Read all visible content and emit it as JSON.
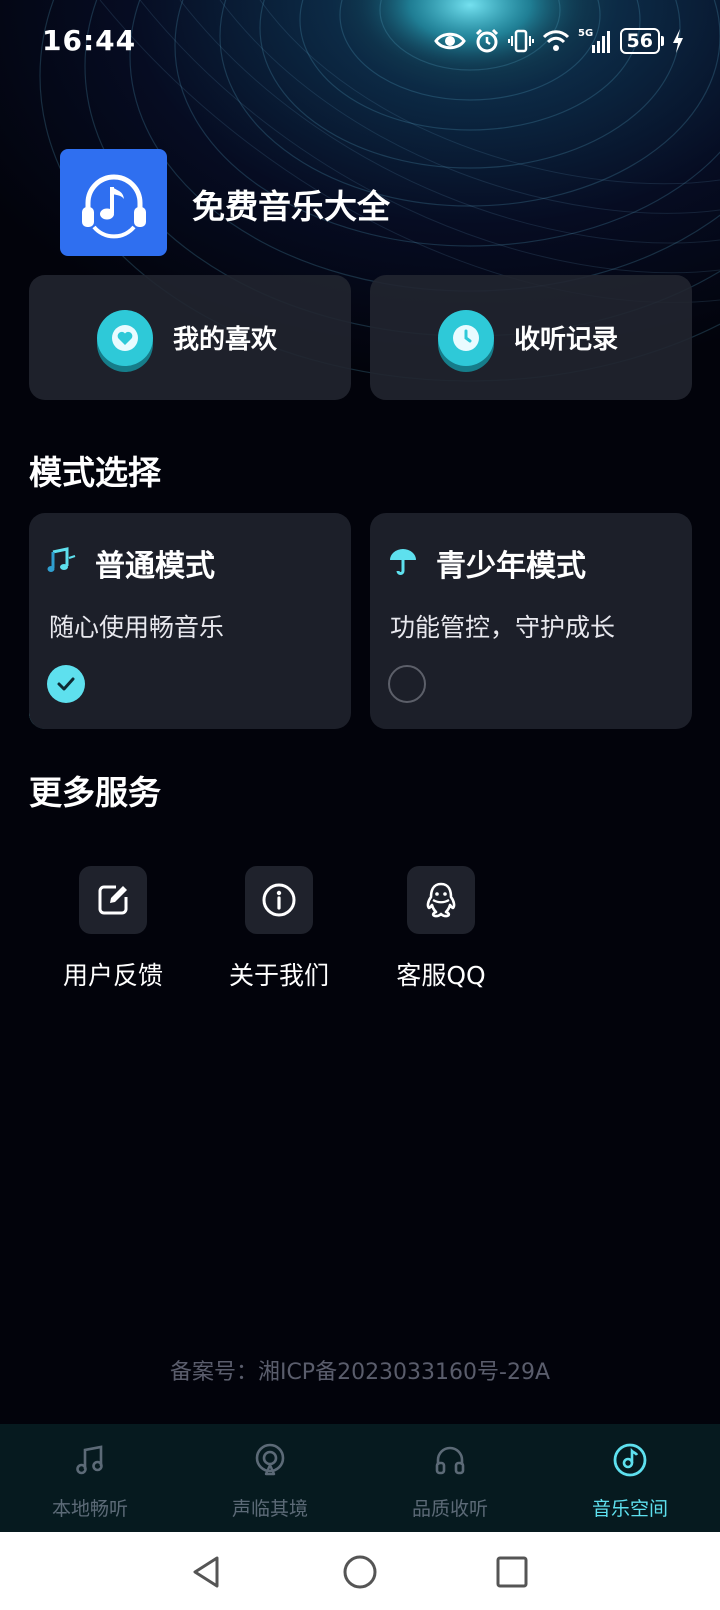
{
  "status_bar": {
    "time": "16:44",
    "network": "5G",
    "battery": "56",
    "icons": [
      "eye-icon",
      "alarm-icon",
      "vibrate-icon",
      "wifi-icon",
      "signal-icon",
      "battery-icon",
      "charging-icon"
    ]
  },
  "header": {
    "app_name": "免费音乐大全",
    "logo_icon": "headphones-music-icon"
  },
  "quick_actions": [
    {
      "label": "我的喜欢",
      "icon": "heart-icon"
    },
    {
      "label": "收听记录",
      "icon": "clock-icon"
    }
  ],
  "mode_section": {
    "title": "模式选择",
    "modes": [
      {
        "title": "普通模式",
        "desc": "随心使用畅音乐",
        "icon": "music-notes-icon",
        "selected": true
      },
      {
        "title": "青少年模式",
        "desc": "功能管控，守护成长",
        "icon": "umbrella-icon",
        "selected": false
      }
    ]
  },
  "services_section": {
    "title": "更多服务",
    "items": [
      {
        "label": "用户反馈",
        "icon": "edit-icon"
      },
      {
        "label": "关于我们",
        "icon": "info-icon"
      },
      {
        "label": "客服QQ",
        "icon": "qq-icon"
      }
    ]
  },
  "icp": "备案号：湘ICP备2023033160号-29A",
  "bottom_nav": {
    "active_index": 3,
    "items": [
      {
        "label": "本地畅听",
        "icon": "music-note-icon"
      },
      {
        "label": "声临其境",
        "icon": "podcast-icon"
      },
      {
        "label": "品质收听",
        "icon": "headphones-icon"
      },
      {
        "label": "音乐空间",
        "icon": "music-disc-icon"
      }
    ]
  },
  "colors": {
    "accent": "#5ee0ee",
    "logo_bg": "#2f6ff0",
    "card_bg": "#1c1f29",
    "page_bg": "#02030b",
    "nav_bg": "#061a1f"
  }
}
